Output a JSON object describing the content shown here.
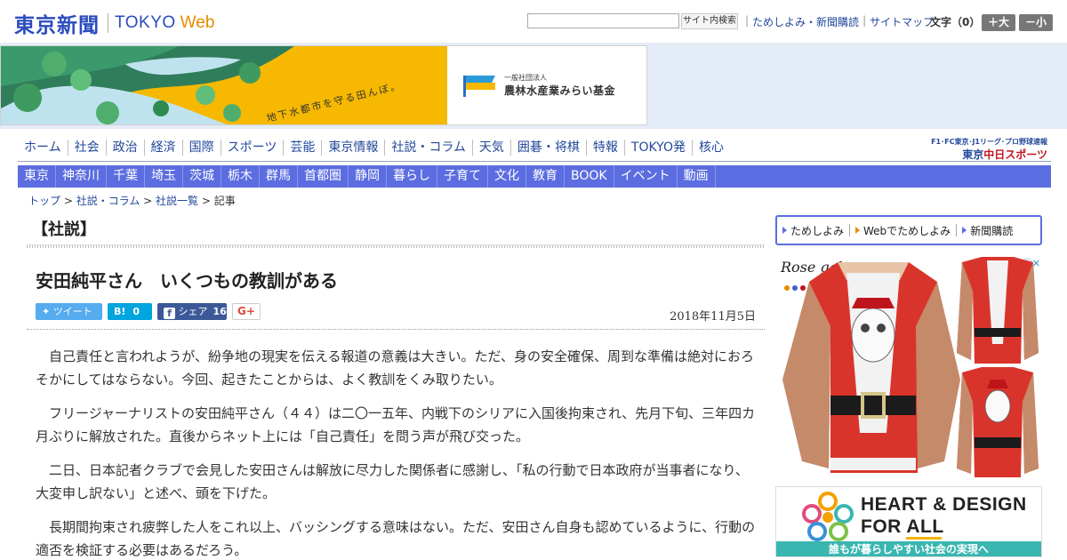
{
  "header": {
    "logo_jp": "東京新聞",
    "logo_en": "TOKYO",
    "logo_web": "Web",
    "search_placeholder": "",
    "search_button": "サイト内検索",
    "util_links": [
      "ためしよみ・新聞購読",
      "サイトマップ"
    ],
    "font_size_label": "文字（0）",
    "font_bigger": "＋大",
    "font_smaller": "－小"
  },
  "banner": {
    "tagline": "地下水都市を守る田んぼ。",
    "org_small": "一般社団法人",
    "org_name": "農林水産業みらい基金",
    "flag_text": "みらい基金"
  },
  "nav_primary": [
    "ホーム",
    "社会",
    "政治",
    "経済",
    "国際",
    "スポーツ",
    "芸能",
    "東京情報",
    "社説・コラム",
    "天気",
    "囲碁・将棋",
    "特報",
    "TOKYO発",
    "核心"
  ],
  "chunichi": {
    "top": "F1･FC東京･J1リーグ･プロ野球速報",
    "logo_prefix": "東京",
    "logo_name": "中日スポーツ"
  },
  "nav_secondary": [
    "東京",
    "神奈川",
    "千葉",
    "埼玉",
    "茨城",
    "栃木",
    "群馬",
    "首都圏",
    "静岡",
    "暮らし",
    "子育て",
    "文化",
    "教育",
    "BOOK",
    "イベント",
    "動画"
  ],
  "breadcrumb": {
    "items": [
      "トップ",
      "社説・コラム",
      "社説一覧"
    ],
    "current": "記事",
    "separator": " > "
  },
  "article": {
    "section": "【社説】",
    "title": "安田純平さん　いくつもの教訓がある",
    "date": "2018年11月5日",
    "share": {
      "tweet": "ツイート",
      "hatena_label": "B!",
      "hatena_count": "0",
      "facebook": "シェア",
      "facebook_count": "16",
      "gplus": "G+"
    },
    "paragraphs": [
      "自己責任と言われようが、紛争地の現実を伝える報道の意義は大きい。ただ、身の安全確保、周到な準備は絶対におろそかにしてはならない。今回、起きたことからは、よく教訓をくみ取りたい。",
      "フリージャーナリストの安田純平さん（４４）は二〇一五年、内戦下のシリアに入国後拘束され、先月下旬、三年四カ月ぶりに解放された。直後からネット上には「自己責任」を問う声が飛び交った。",
      "二日、日本記者クラブで会見した安田さんは解放に尽力した関係者に感謝し、「私の行動で日本政府が当事者になり、大変申し訳ない」と述べ、頭を下げた。",
      "長期間拘束され疲弊した人をこれ以上、バッシングする意味はない。ただ、安田さん自身も認めているように、行動の適否を検証する必要はあるだろう。"
    ]
  },
  "sidebar": {
    "promo": [
      "ためしよみ",
      "Webでためしよみ",
      "新聞購読"
    ],
    "shirt_brand": "Rose gal",
    "adchoice": "ⓘ✕",
    "heart_line1": "HEART & DESIGN",
    "heart_line2": "FOR ALL",
    "heart_strip": "誰もが暮らしやすい社会の実現へ"
  }
}
